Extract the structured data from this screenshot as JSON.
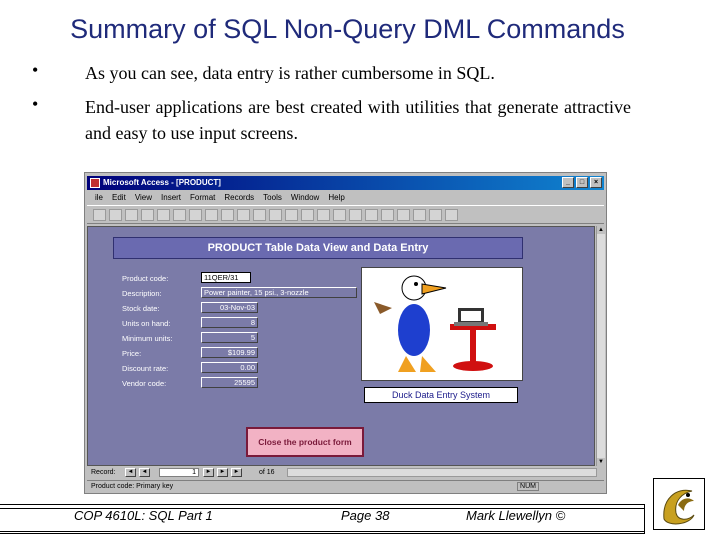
{
  "slide": {
    "title": "Summary of SQL Non-Query DML Commands",
    "bullets": [
      "As you can see, data entry is rather cumbersome in SQL.",
      "End-user applications are best created with utilities that generate attractive and easy to use input screens."
    ],
    "bullet_glyph": "•"
  },
  "window": {
    "title": "Microsoft Access - [PRODUCT]",
    "menu": [
      "ile",
      "Edit",
      "View",
      "Insert",
      "Format",
      "Records",
      "Tools",
      "Window",
      "Help"
    ],
    "controls": [
      "_",
      "□",
      "×"
    ]
  },
  "form": {
    "header": "PRODUCT Table Data View and Data Entry",
    "fields": [
      {
        "label": "Product code:",
        "value": "11QER/31"
      },
      {
        "label": "Description:",
        "value": "Power painter, 15 psi., 3-nozzle"
      },
      {
        "label": "Stock date:",
        "value": "03-Nov-03"
      },
      {
        "label": "Units on hand:",
        "value": "8"
      },
      {
        "label": "Minimum units:",
        "value": "5"
      },
      {
        "label": "Price:",
        "value": "$109.99"
      },
      {
        "label": "Discount rate:",
        "value": "0.00"
      },
      {
        "label": "Vendor code:",
        "value": "25595"
      }
    ],
    "image_caption": "Duck Data Entry System",
    "close_button": "Close the product form"
  },
  "navigation": {
    "record_label": "Record:",
    "record_number": "1",
    "of_label": "of 16"
  },
  "status": {
    "message": "Product code: Primary key",
    "indicator": "NUM"
  },
  "footer": {
    "course": "COP 4610L: SQL Part 1",
    "page": "Page 38",
    "author": "Mark Llewellyn ©"
  },
  "colors": {
    "title": "#1f2a7a",
    "form_background": "#7b7ba8",
    "close_button": "#f2b2c4"
  }
}
